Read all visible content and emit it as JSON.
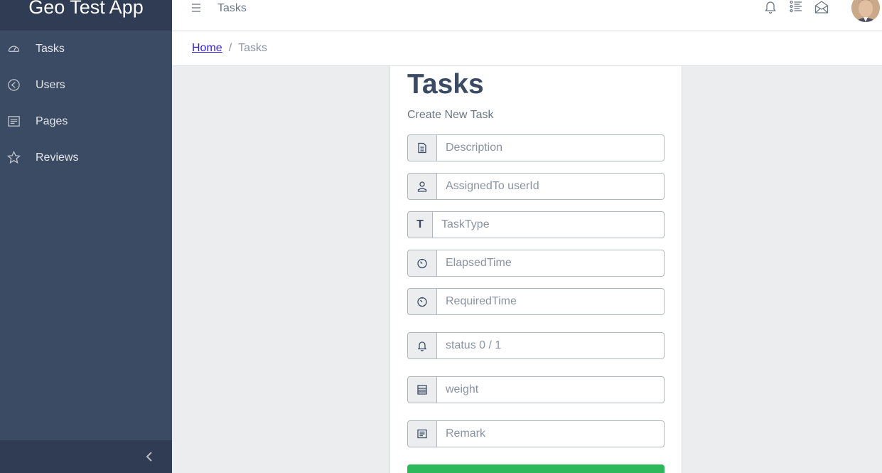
{
  "sidebar": {
    "brand": "Geo Test App",
    "items": [
      {
        "label": "Tasks",
        "icon": "speedometer-icon"
      },
      {
        "label": "Users",
        "icon": "compass-icon"
      },
      {
        "label": "Pages",
        "icon": "notes-icon"
      },
      {
        "label": "Reviews",
        "icon": "star-icon"
      }
    ]
  },
  "header": {
    "title": "Tasks"
  },
  "breadcrumb": {
    "home": "Home",
    "separator": "/",
    "current": "Tasks"
  },
  "form": {
    "title": "Tasks",
    "subtitle": "Create New Task",
    "fields": [
      {
        "placeholder": "Description",
        "icon": "document-icon"
      },
      {
        "placeholder": "AssignedTo userId",
        "icon": "user-icon"
      },
      {
        "placeholder": "TaskType",
        "prefix": "T"
      },
      {
        "placeholder": "ElapsedTime",
        "icon": "timer-icon"
      },
      {
        "placeholder": "RequiredTime",
        "icon": "timer-icon"
      },
      {
        "placeholder": "status 0 / 1",
        "icon": "bell-icon"
      },
      {
        "placeholder": "weight",
        "icon": "storage-icon"
      },
      {
        "placeholder": "Remark",
        "icon": "notes-icon"
      }
    ]
  },
  "colors": {
    "sidebar": "#3c4b64",
    "submit": "#2eb85c",
    "link": "#321fdb"
  }
}
